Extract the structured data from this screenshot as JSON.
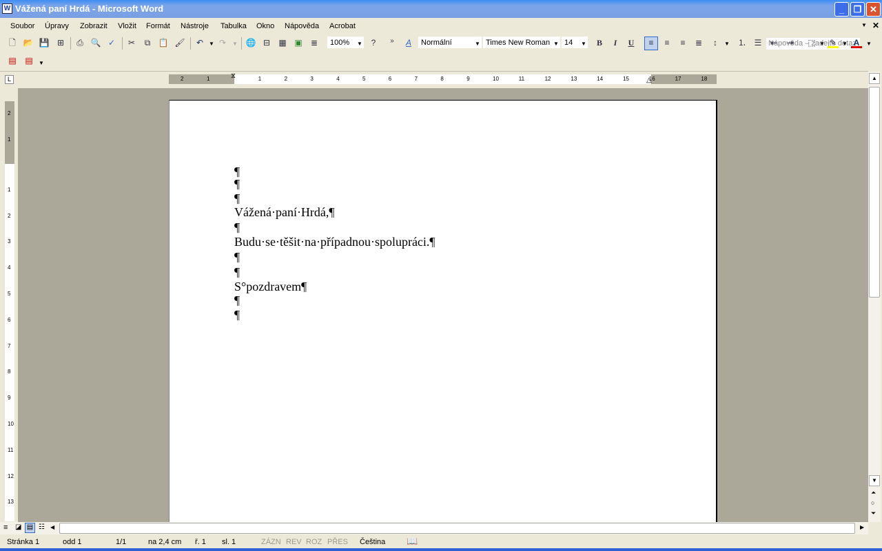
{
  "window": {
    "title": "Vážená paní Hrdá - Microsoft Word",
    "app_icon": "W"
  },
  "menu": [
    "Soubor",
    "Úpravy",
    "Zobrazit",
    "Vložit",
    "Formát",
    "Nástroje",
    "Tabulka",
    "Okno",
    "Nápověda",
    "Acrobat"
  ],
  "help_placeholder": "Nápověda – zadejte dotaz",
  "toolbar": {
    "zoom": "100%",
    "style": "Normální",
    "font": "Times New Roman",
    "size": "14",
    "bold": "B",
    "italic": "I",
    "underline": "U"
  },
  "ruler": {
    "h_neg": [
      "2",
      "1"
    ],
    "h": [
      "1",
      "2",
      "3",
      "4",
      "5",
      "6",
      "7",
      "8",
      "9",
      "10",
      "11",
      "12",
      "13",
      "14",
      "15",
      "16",
      "17",
      "18"
    ],
    "v_neg": [
      "2",
      "1"
    ],
    "v": [
      "1",
      "2",
      "3",
      "4",
      "5",
      "6",
      "7",
      "8",
      "9",
      "10",
      "11",
      "12",
      "13"
    ]
  },
  "document": {
    "paragraphs": [
      "¶",
      "¶",
      "¶",
      "Vážená·paní·Hrdá,¶",
      "¶",
      "Budu·se·těšit·na·případnou·spolupráci.¶",
      "¶",
      "¶",
      "S°pozdravem¶",
      "¶",
      "¶"
    ]
  },
  "status": {
    "page": "Stránka 1",
    "section": "odd 1",
    "pages": "1/1",
    "position": "na 2,4 cm",
    "line": "ř. 1",
    "column": "sl. 1",
    "rec": "ZÁZN",
    "rev": "REV",
    "ext": "ROZ",
    "ovr": "PŘES",
    "language": "Čeština"
  }
}
